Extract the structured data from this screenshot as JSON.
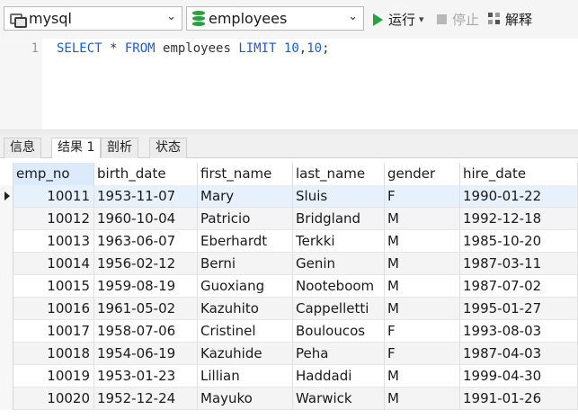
{
  "toolbar": {
    "connection": "mysql",
    "database": "employees",
    "run_label": "运行",
    "run_dropdown": "▾",
    "stop_label": "停止",
    "explain_label": "解释"
  },
  "editor": {
    "line_number": "1",
    "sql_tokens": [
      {
        "text": "SELECT",
        "type": "kw"
      },
      {
        "text": " * ",
        "type": "plain"
      },
      {
        "text": "FROM",
        "type": "kw"
      },
      {
        "text": " employees ",
        "type": "plain"
      },
      {
        "text": "LIMIT",
        "type": "kw"
      },
      {
        "text": " ",
        "type": "plain"
      },
      {
        "text": "10",
        "type": "num"
      },
      {
        "text": ",",
        "type": "plain"
      },
      {
        "text": "10",
        "type": "num"
      },
      {
        "text": ";",
        "type": "plain"
      }
    ]
  },
  "tabs": [
    {
      "label": "信息",
      "active": false
    },
    {
      "label": "结果 1",
      "active": true
    },
    {
      "label": "剖析",
      "active": false
    },
    {
      "label": "状态",
      "active": false
    }
  ],
  "table": {
    "columns": [
      "emp_no",
      "birth_date",
      "first_name",
      "last_name",
      "gender",
      "hire_date"
    ],
    "selected_column": "emp_no",
    "rows": [
      [
        "10011",
        "1953-11-07",
        "Mary",
        "Sluis",
        "F",
        "1990-01-22"
      ],
      [
        "10012",
        "1960-10-04",
        "Patricio",
        "Bridgland",
        "M",
        "1992-12-18"
      ],
      [
        "10013",
        "1963-06-07",
        "Eberhardt",
        "Terkki",
        "M",
        "1985-10-20"
      ],
      [
        "10014",
        "1956-02-12",
        "Berni",
        "Genin",
        "M",
        "1987-03-11"
      ],
      [
        "10015",
        "1959-08-19",
        "Guoxiang",
        "Nooteboom",
        "M",
        "1987-07-02"
      ],
      [
        "10016",
        "1961-05-02",
        "Kazuhito",
        "Cappelletti",
        "M",
        "1995-01-27"
      ],
      [
        "10017",
        "1958-07-06",
        "Cristinel",
        "Bouloucos",
        "F",
        "1993-08-03"
      ],
      [
        "10018",
        "1954-06-19",
        "Kazuhide",
        "Peha",
        "F",
        "1987-04-03"
      ],
      [
        "10019",
        "1953-01-23",
        "Lillian",
        "Haddadi",
        "M",
        "1999-04-30"
      ],
      [
        "10020",
        "1952-12-24",
        "Mayuko",
        "Warwick",
        "M",
        "1991-01-26"
      ]
    ],
    "current_row": 0
  }
}
